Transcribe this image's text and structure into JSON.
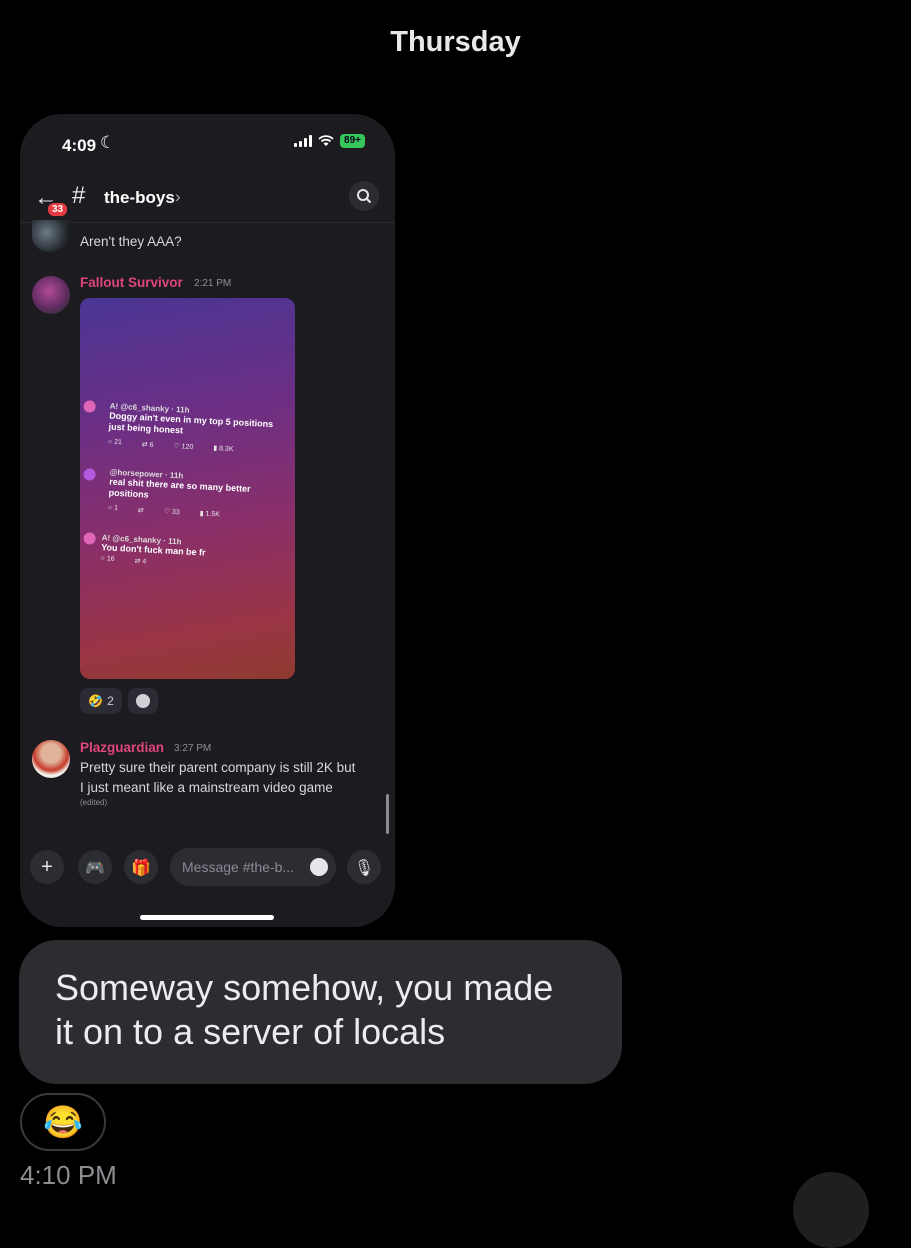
{
  "day_header": "Thursday",
  "screenshot": {
    "status_bar": {
      "time": "4:09",
      "battery": "89+"
    },
    "channel": {
      "name": "the-boys",
      "unread_count": "33"
    },
    "messages": [
      {
        "text": "Aren't they AAA?"
      },
      {
        "username": "Fallout Survivor",
        "timestamp": "2:21 PM"
      },
      {
        "username": "Plazguardian",
        "timestamp": "3:27 PM",
        "text_line1": "Pretty sure their parent company is still 2K but",
        "text_line2": "I just meant like a mainstream video game",
        "edited": "(edited)"
      }
    ],
    "embedded_tweets": [
      {
        "handle": "A! @c6_shanky · 11h",
        "line1": "Doggy ain't even in my top 5 positions",
        "line2": "just being honest",
        "replies": "21",
        "reposts": "6",
        "likes": "120",
        "views": "8.3K"
      },
      {
        "handle": "@horsepower · 11h",
        "line1": "real shit there are so many better",
        "line2": "positions",
        "replies": "1",
        "reposts": "",
        "likes": "33",
        "views": "1.5K"
      },
      {
        "handle": "A! @c6_shanky · 11h",
        "line1": "You don't fuck man be fr",
        "line2": "",
        "replies": "16",
        "reposts": "4",
        "likes": "",
        "views": ""
      }
    ],
    "reaction": {
      "emoji": "🤣",
      "count": "2"
    },
    "input_placeholder": "Message #the-b..."
  },
  "bubble_text_line1": "Someway somehow, you made",
  "bubble_text_line2": "it on to a server of locals",
  "message_reaction": "😂",
  "message_time": "4:10 PM"
}
